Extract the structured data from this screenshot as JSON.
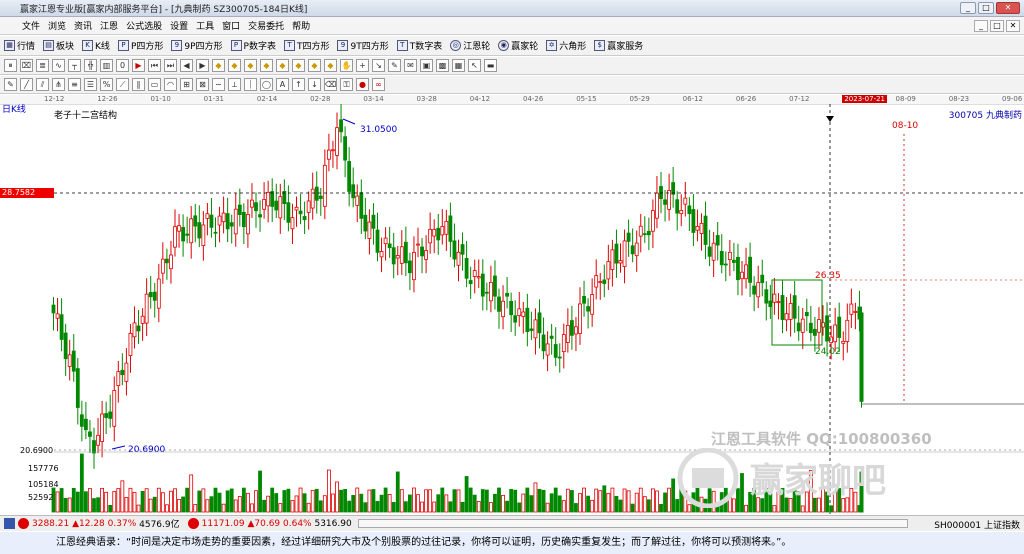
{
  "title_bar": {
    "title": "赢家江恩专业版[赢家内部服务平台] - [九典制药  SZ300705-184日K线]"
  },
  "menu": [
    "文件",
    "浏览",
    "资讯",
    "江恩",
    "公式选股",
    "设置",
    "工具",
    "窗口",
    "交易委托",
    "帮助"
  ],
  "toolbar1": [
    {
      "label": "行情",
      "icon": "grid-icon"
    },
    {
      "label": "板块",
      "icon": "board-icon"
    },
    {
      "label": "K线",
      "icon": "kline-icon"
    },
    {
      "label": "P四方形",
      "icon": "p-square-icon"
    },
    {
      "label": "9P四方形",
      "icon": "9p-square-icon"
    },
    {
      "label": "P数字表",
      "icon": "p-table-icon"
    },
    {
      "label": "T四方形",
      "icon": "t-square-icon"
    },
    {
      "label": "9T四方形",
      "icon": "9t-square-icon"
    },
    {
      "label": "T数字表",
      "icon": "t-table-icon"
    },
    {
      "label": "江恩轮",
      "icon": "gann-wheel-icon"
    },
    {
      "label": "赢家轮",
      "icon": "winner-wheel-icon"
    },
    {
      "label": "六角形",
      "icon": "hexagon-icon"
    },
    {
      "label": "赢家服务",
      "icon": "service-icon"
    }
  ],
  "date_ticks": [
    "12-12",
    "12-26",
    "01-10",
    "01-31",
    "02-14",
    "02-28",
    "03-14",
    "03-28",
    "04-12",
    "04-26",
    "05-15",
    "05-29",
    "06-12",
    "06-26",
    "07-12",
    "2023-07-21",
    "08-09",
    "08-23",
    "09-06"
  ],
  "chart_labels": {
    "period": "日K线",
    "structure": "老子十二宫结构",
    "stock": "300705  九典制药",
    "price_marker": "28.7582",
    "high": "31.0500",
    "low": "20.6900",
    "low_axis": "20.6900",
    "box_top": "26.35",
    "box_bottom": "24.02",
    "future_date": "08-10",
    "vol_ticks": [
      "157776",
      "105184",
      "52592"
    ]
  },
  "watermark": {
    "line1": "江恩工具软件   QQ:100800360",
    "line2": "赢家聊吧"
  },
  "status": {
    "sh_value": "3288.21",
    "sh_change": "▲12.28",
    "sh_pct": "0.37%",
    "sh_amount": "4576.9亿",
    "sz_value": "11171.09",
    "sz_change": "▲70.69",
    "sz_pct": "0.64%",
    "sz_amount": "5316.90",
    "right": "SH000001 上证指数"
  },
  "quote": "江恩经典语录：“时间是决定市场走势的重要因素，经过详细研究大市及个别股票的过往记录，你将可以证明，历史确实重复发生；而了解过往，你将可以预测将来。”。",
  "colors": {
    "up": "#e00000",
    "down": "#008800",
    "accent": "#0000cc"
  }
}
